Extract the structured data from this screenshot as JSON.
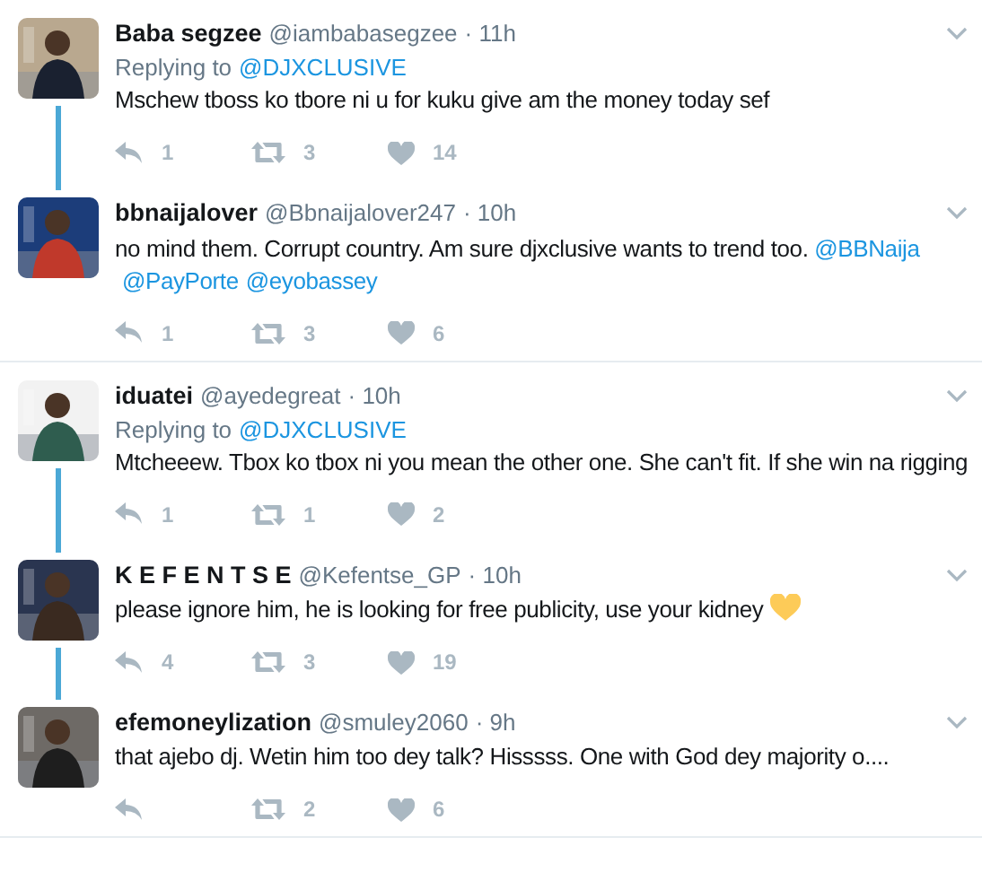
{
  "tweets": [
    {
      "name": "Baba segzee",
      "handle": "@iambabasegzee",
      "time": "· 11h",
      "replying_label": "Replying to",
      "replying_to": "@DJXCLUSIVE",
      "text": [
        {
          "kind": "plain",
          "text": "Mschew tboss ko tbore ni u for kuku give am the money today sef"
        }
      ],
      "replies": "1",
      "retweets": "3",
      "likes": "14",
      "connected_above": false,
      "connected_below": true
    },
    {
      "name": "bbnaijalover",
      "handle": "@Bbnaijalover247",
      "time": "· 10h",
      "text": [
        {
          "kind": "plain",
          "text": "no mind them. Corrupt country. Am sure djxclusive wants to trend too. "
        },
        {
          "kind": "mention",
          "text": "@BBNaija"
        },
        {
          "kind": "mention",
          "text": "@PayPorte"
        },
        {
          "kind": "mention",
          "text": "@eyobassey"
        }
      ],
      "replies": "1",
      "retweets": "3",
      "likes": "6",
      "connected_above": true,
      "connected_below": false
    },
    {
      "name": "iduatei",
      "handle": "@ayedegreat",
      "time": "· 10h",
      "replying_label": "Replying to",
      "replying_to": "@DJXCLUSIVE",
      "text": [
        {
          "kind": "plain",
          "text": "Mtcheeew. Tbox ko tbox ni you mean the other one. She can't fit. If she win na rigging"
        }
      ],
      "replies": "1",
      "retweets": "1",
      "likes": "2",
      "connected_above": false,
      "connected_below": true
    },
    {
      "name": "K E F E N T S E",
      "handle": "@Kefentse_GP",
      "time": "· 10h",
      "text": [
        {
          "kind": "plain",
          "text": "please ignore him, he is looking for free publicity, use your kidney "
        },
        {
          "kind": "heart_emoji"
        }
      ],
      "replies": "4",
      "retweets": "3",
      "likes": "19",
      "connected_above": true,
      "connected_below": true
    },
    {
      "name": "efemoneylization",
      "handle": "@smuley2060",
      "time": "· 9h",
      "text": [
        {
          "kind": "plain",
          "text": "that ajebo dj. Wetin him too dey talk? Hisssss. One with God dey majority o...."
        }
      ],
      "retweets": "2",
      "likes": "6",
      "connected_above": true,
      "connected_below": false
    }
  ]
}
